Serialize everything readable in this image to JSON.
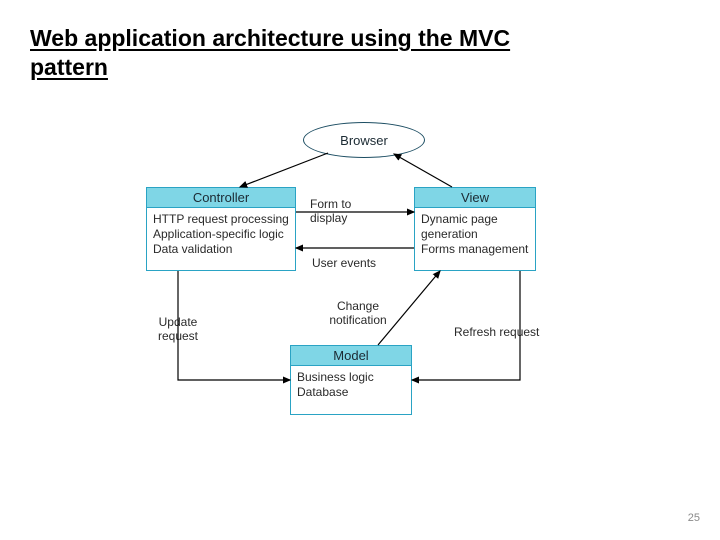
{
  "title": "Web application architecture using the MVC pattern",
  "page_number": "25",
  "browser": {
    "label": "Browser"
  },
  "controller": {
    "title": "Controller",
    "line1": "HTTP request processing",
    "line2": "Application-specific logic",
    "line3": "Data validation"
  },
  "view": {
    "title": "View",
    "line1": "Dynamic page",
    "line2": "generation",
    "line3": "Forms management"
  },
  "model": {
    "title": "Model",
    "line1": "Business logic",
    "line2": "Database"
  },
  "labels": {
    "form_to_display": "Form to\ndisplay",
    "user_events": "User events",
    "change_notification": "Change\nnotification",
    "update_request": "Update\nrequest",
    "refresh_request": "Refresh request"
  }
}
